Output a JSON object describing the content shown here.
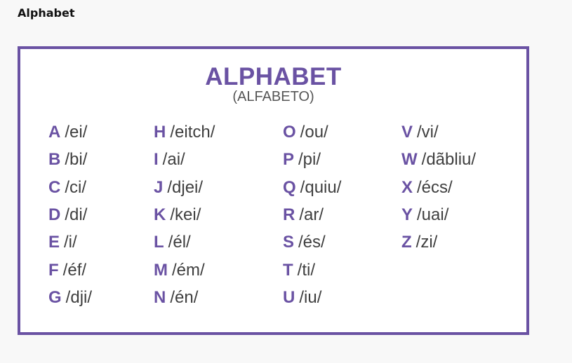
{
  "page": {
    "heading": "Alphabet"
  },
  "card": {
    "title": "ALPHABET",
    "subtitle": "(ALFABETO)",
    "accent_color": "#6a52a3",
    "columns": [
      [
        {
          "letter": "A",
          "pron": "/ei/"
        },
        {
          "letter": "B",
          "pron": "/bi/"
        },
        {
          "letter": "C",
          "pron": "/ci/"
        },
        {
          "letter": "D",
          "pron": "/di/"
        },
        {
          "letter": "E",
          "pron": "/i/"
        },
        {
          "letter": "F",
          "pron": "/éf/"
        },
        {
          "letter": "G",
          "pron": "/dji/"
        }
      ],
      [
        {
          "letter": "H",
          "pron": "/eitch/"
        },
        {
          "letter": "I",
          "pron": "/ai/"
        },
        {
          "letter": "J",
          "pron": "/djei/"
        },
        {
          "letter": "K",
          "pron": "/kei/"
        },
        {
          "letter": "L",
          "pron": "/él/"
        },
        {
          "letter": "M",
          "pron": "/ém/"
        },
        {
          "letter": "N",
          "pron": "/én/"
        }
      ],
      [
        {
          "letter": "O",
          "pron": "/ou/"
        },
        {
          "letter": "P",
          "pron": "/pi/"
        },
        {
          "letter": "Q",
          "pron": "/quiu/"
        },
        {
          "letter": "R",
          "pron": "/ar/"
        },
        {
          "letter": "S",
          "pron": "/és/"
        },
        {
          "letter": "T",
          "pron": "/ti/"
        },
        {
          "letter": "U",
          "pron": "/iu/"
        }
      ],
      [
        {
          "letter": "V",
          "pron": "/vi/"
        },
        {
          "letter": "W",
          "pron": "/dãbliu/"
        },
        {
          "letter": "X",
          "pron": "/écs/"
        },
        {
          "letter": "Y",
          "pron": "/uai/"
        },
        {
          "letter": "Z",
          "pron": "/zi/"
        }
      ]
    ]
  }
}
